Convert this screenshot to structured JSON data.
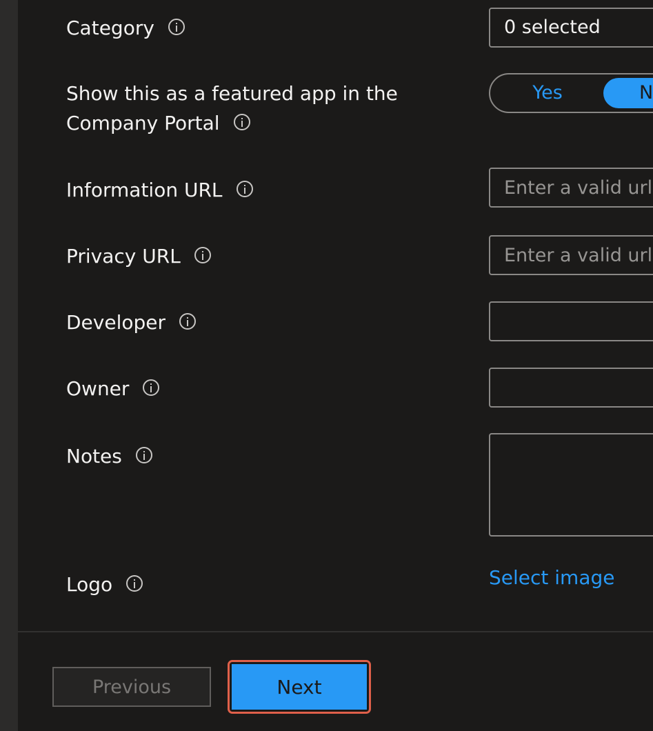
{
  "form": {
    "category": {
      "label": "Category",
      "value": "0 selected"
    },
    "featured": {
      "label_line1": "Show this as a featured app in the",
      "label_line2": "Company Portal",
      "yes_label": "Yes",
      "no_label": "No",
      "selected": "No"
    },
    "information_url": {
      "label": "Information URL",
      "value": "",
      "placeholder": "Enter a valid url"
    },
    "privacy_url": {
      "label": "Privacy URL",
      "value": "",
      "placeholder": "Enter a valid url"
    },
    "developer": {
      "label": "Developer",
      "value": ""
    },
    "owner": {
      "label": "Owner",
      "value": ""
    },
    "notes": {
      "label": "Notes",
      "value": ""
    },
    "logo": {
      "label": "Logo",
      "link_label": "Select image"
    }
  },
  "footer": {
    "previous_label": "Previous",
    "next_label": "Next"
  },
  "colors": {
    "background": "#1b1a19",
    "accent": "#2899f5",
    "highlight": "#e0604a"
  },
  "icons": {
    "info": "info-icon"
  }
}
